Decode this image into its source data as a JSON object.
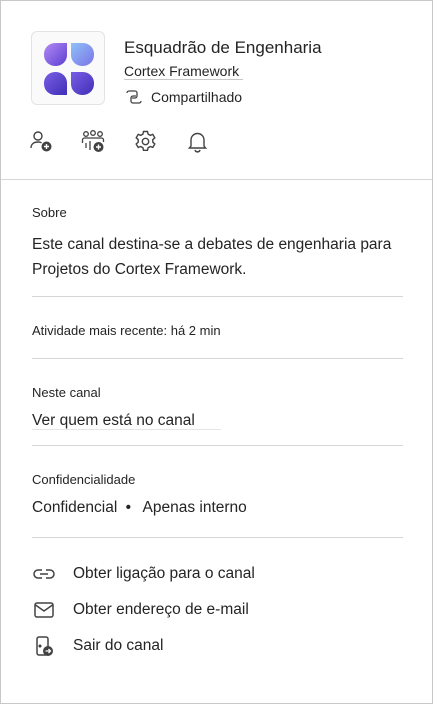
{
  "team": {
    "name": "Esquadrão de Engenharia",
    "subtitle": "Cortex Framework",
    "shared_label": "Compartilhado",
    "logo_icon": "four-petal-logo-icon"
  },
  "actions": [
    {
      "name": "add-member-icon"
    },
    {
      "name": "add-team-icon"
    },
    {
      "name": "settings-gear-icon"
    },
    {
      "name": "notification-bell-icon"
    }
  ],
  "about": {
    "heading": "Sobre",
    "description": "Este canal destina-se a debates de engenharia para Projetos do Cortex Framework."
  },
  "activity": {
    "text": "Atividade mais recente: há 2 min"
  },
  "in_channel": {
    "heading": "Neste canal",
    "link": "Ver quem está no canal"
  },
  "confidentiality": {
    "heading": "Confidencialidade",
    "level": "Confidencial",
    "separator": "•",
    "scope": "Apenas interno"
  },
  "links": [
    {
      "icon": "link-icon",
      "label": "Obter ligação para o canal"
    },
    {
      "icon": "mail-icon",
      "label": "Obter endereço de e-mail"
    },
    {
      "icon": "leave-channel-icon",
      "label": "Sair do canal"
    }
  ],
  "colors": {
    "logo_gradient_start": "#9b7cf0",
    "logo_gradient_end": "#4e3fc9",
    "divider": "#d6d6d6",
    "text": "#242424"
  }
}
